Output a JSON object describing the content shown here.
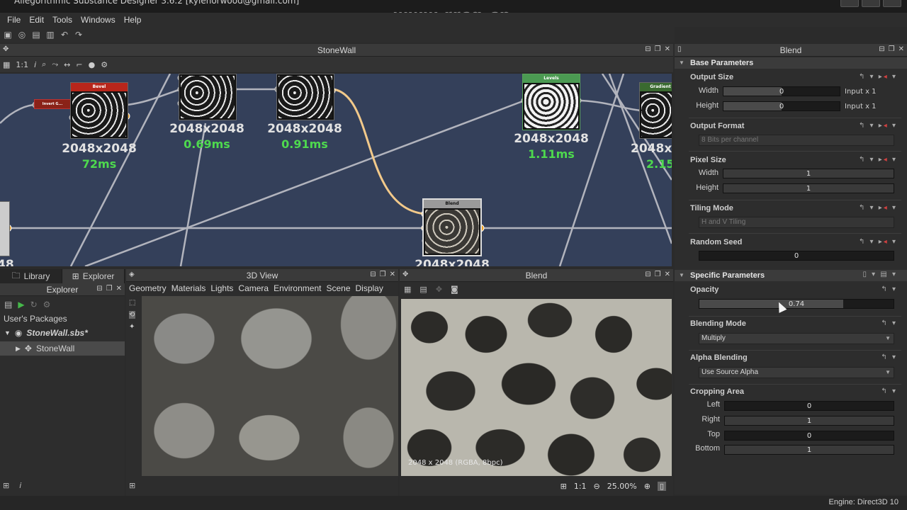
{
  "window": {
    "title": "Allegorithmic Substance Designer 3.6.2 [kylenorwood@gmail.com]",
    "watermark": "www.rrcg.cn"
  },
  "menu": [
    "File",
    "Edit",
    "Tools",
    "Windows",
    "Help"
  ],
  "graph": {
    "title": "StoneWall",
    "zoom_label": "1:1",
    "nodes": [
      {
        "name": "Bevel",
        "size": "2048x2048",
        "time": "72ms",
        "header_color": "#b8261b"
      },
      {
        "name": "",
        "size": "2048x2048",
        "time": "0.69ms"
      },
      {
        "name": "",
        "size": "2048x2048",
        "time": "0.91ms"
      },
      {
        "name": "Levels",
        "size": "2048x2048",
        "time": "1.11ms",
        "header_color": "#4b9a52"
      },
      {
        "name": "Gradient",
        "size": "2048x",
        "time": "2.15",
        "header_color": "#3a6a30"
      },
      {
        "name": "Blend",
        "size": "2048x2048",
        "header_color": "#8c8c8c"
      },
      {
        "name": "Invert G...",
        "header_color": "#b8261b"
      }
    ],
    "left_edge_fragment": "48"
  },
  "left_panel": {
    "tabs": [
      "Library",
      "Explorer"
    ],
    "header": "Explorer",
    "section": "User's Packages",
    "package": "StoneWall.sbs*",
    "graph_item": "StoneWall"
  },
  "view3d": {
    "title": "3D View",
    "menu": [
      "Geometry",
      "Materials",
      "Lights",
      "Camera",
      "Environment",
      "Scene",
      "Display"
    ]
  },
  "view2d": {
    "title": "Blend",
    "info": "2048 x 2048 (RGBA, 8bpc)",
    "ratio": "1:1",
    "zoom": "25.00%"
  },
  "properties": {
    "title": "Blend",
    "base_section": "Base Parameters",
    "output_size": {
      "label": "Output Size",
      "width_label": "Width",
      "height_label": "Height",
      "width": "0",
      "height": "0",
      "width_suffix": "Input x 1",
      "height_suffix": "Input x 1"
    },
    "output_format": {
      "label": "Output Format",
      "value": "8 Bits per channel"
    },
    "pixel_size": {
      "label": "Pixel Size",
      "width_label": "Width",
      "height_label": "Height",
      "width": "1",
      "height": "1"
    },
    "tiling_mode": {
      "label": "Tiling Mode",
      "value": "H and V Tiling"
    },
    "random_seed": {
      "label": "Random Seed",
      "value": "0"
    },
    "specific_section": "Specific Parameters",
    "opacity": {
      "label": "Opacity",
      "value": "0.74",
      "fraction": 0.74
    },
    "blending_mode": {
      "label": "Blending Mode",
      "value": "Multiply"
    },
    "alpha_blending": {
      "label": "Alpha Blending",
      "value": "Use Source Alpha"
    },
    "cropping": {
      "label": "Cropping Area",
      "left_label": "Left",
      "right_label": "Right",
      "top_label": "Top",
      "bottom_label": "Bottom",
      "left": "0",
      "right": "1",
      "top": "0",
      "bottom": "1"
    }
  },
  "status": {
    "engine": "Engine: Direct3D 10"
  }
}
